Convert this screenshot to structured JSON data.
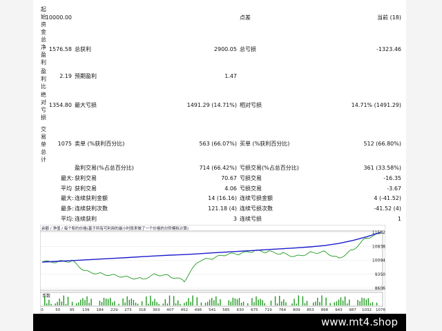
{
  "sidebar": {
    "labels": [
      "起始资金",
      "总净盈利",
      "盈利比",
      "绝对亏损",
      "交易单总计"
    ]
  },
  "rows": [
    {
      "c1": "10000.00",
      "c2": "",
      "c3": "",
      "c4": "点差",
      "c5": "",
      "c6": "当前 (18)"
    },
    {
      "c1": "1576.58",
      "c2": "总获利",
      "c3": "2900.05",
      "c4": "总亏损",
      "c5": "",
      "c6": "-1323.46"
    },
    {
      "c1": "2.19",
      "c2": "预期盈利",
      "c3": "1.47",
      "c4": "",
      "c5": "",
      "c6": ""
    },
    {
      "c1": "1354.80",
      "c2": "最大亏损",
      "c3": "1491.29 (14.71%)",
      "c4": "相对亏损",
      "c5": "",
      "c6": "14.71% (1491.29)"
    },
    {
      "c1": "1075",
      "c2": "卖单 (%获利百分比)",
      "c3": "563 (66.07%)",
      "c4": "买单 (%获利百分比)",
      "c5": "",
      "c6": "512 (66.80%)"
    }
  ],
  "detail_rows": [
    {
      "a": "",
      "b": "盈利交易(%占总百分比)",
      "c": "714 (66.42%)",
      "d": "亏损交易(%占总百分比)",
      "e": "361 (33.58%)"
    },
    {
      "a": "最大:",
      "b": "获利交易",
      "c": "70.67",
      "d": "亏损交易",
      "e": "-16.35"
    },
    {
      "a": "平均",
      "b": "获利交易",
      "c": "4.06",
      "d": "亏损交易",
      "e": "-3.67"
    },
    {
      "a": "最大:",
      "b": "连续获利金额",
      "c": "14 (16.16)",
      "d": "连续亏损金额",
      "e": "4 (-41.52)"
    },
    {
      "a": "最多:",
      "b": "连续获利次数",
      "c": "121.18 (4)",
      "d": "连续亏损次数",
      "e": "-41.52 (4)"
    },
    {
      "a": "平均:",
      "b": "连续获利",
      "c": "3",
      "d": "连续亏损",
      "e": "1"
    }
  ],
  "chart": {
    "header": "余额 / 净值 / 每个和约价格(基于所有可利用的最小时段来做了一个价格的分阶模拟计算)",
    "volume_label": "手数",
    "y_ticks": [
      "11582",
      "10838",
      "10094",
      "9350",
      "8606"
    ],
    "x_ticks": [
      "0",
      "50",
      "95",
      "139",
      "184",
      "229",
      "273",
      "318",
      "363",
      "407",
      "452",
      "496",
      "541",
      "585",
      "630",
      "675",
      "719",
      "764",
      "809",
      "853",
      "898",
      "943",
      "987",
      "1032",
      "1076"
    ],
    "colors": {
      "balance": "#1a1acc",
      "equity": "#1c9a1c",
      "volume": "#1c9a1c"
    }
  },
  "chart_data": {
    "type": "line",
    "x_range": [
      0,
      1076
    ],
    "y_range": [
      8606,
      11582
    ],
    "series": [
      {
        "values": [
          [
            0,
            10000
          ],
          [
            50,
            10040
          ],
          [
            95,
            10080
          ],
          [
            139,
            10120
          ],
          [
            184,
            10160
          ],
          [
            229,
            10200
          ],
          [
            273,
            10240
          ],
          [
            318,
            10290
          ],
          [
            363,
            10330
          ],
          [
            407,
            10370
          ],
          [
            452,
            10400
          ],
          [
            496,
            10440
          ],
          [
            541,
            10490
          ],
          [
            585,
            10530
          ],
          [
            630,
            10580
          ],
          [
            675,
            10620
          ],
          [
            719,
            10670
          ],
          [
            764,
            10710
          ],
          [
            809,
            10760
          ],
          [
            853,
            10810
          ],
          [
            898,
            10880
          ],
          [
            943,
            10990
          ],
          [
            987,
            11150
          ],
          [
            1032,
            11350
          ],
          [
            1076,
            11582
          ]
        ]
      },
      {
        "values": [
          [
            0,
            10000
          ],
          [
            50,
            10020
          ],
          [
            95,
            10060
          ],
          [
            139,
            9500
          ],
          [
            184,
            9380
          ],
          [
            229,
            9300
          ],
          [
            273,
            9200
          ],
          [
            318,
            9100
          ],
          [
            363,
            9350
          ],
          [
            407,
            9250
          ],
          [
            452,
            9000
          ],
          [
            496,
            10050
          ],
          [
            541,
            10200
          ],
          [
            585,
            10400
          ],
          [
            630,
            10450
          ],
          [
            675,
            10600
          ],
          [
            719,
            10550
          ],
          [
            764,
            10450
          ],
          [
            809,
            10300
          ],
          [
            853,
            10500
          ],
          [
            898,
            10550
          ],
          [
            943,
            10200
          ],
          [
            987,
            10650
          ],
          [
            1032,
            11300
          ],
          [
            1076,
            11500
          ]
        ]
      }
    ]
  }
}
